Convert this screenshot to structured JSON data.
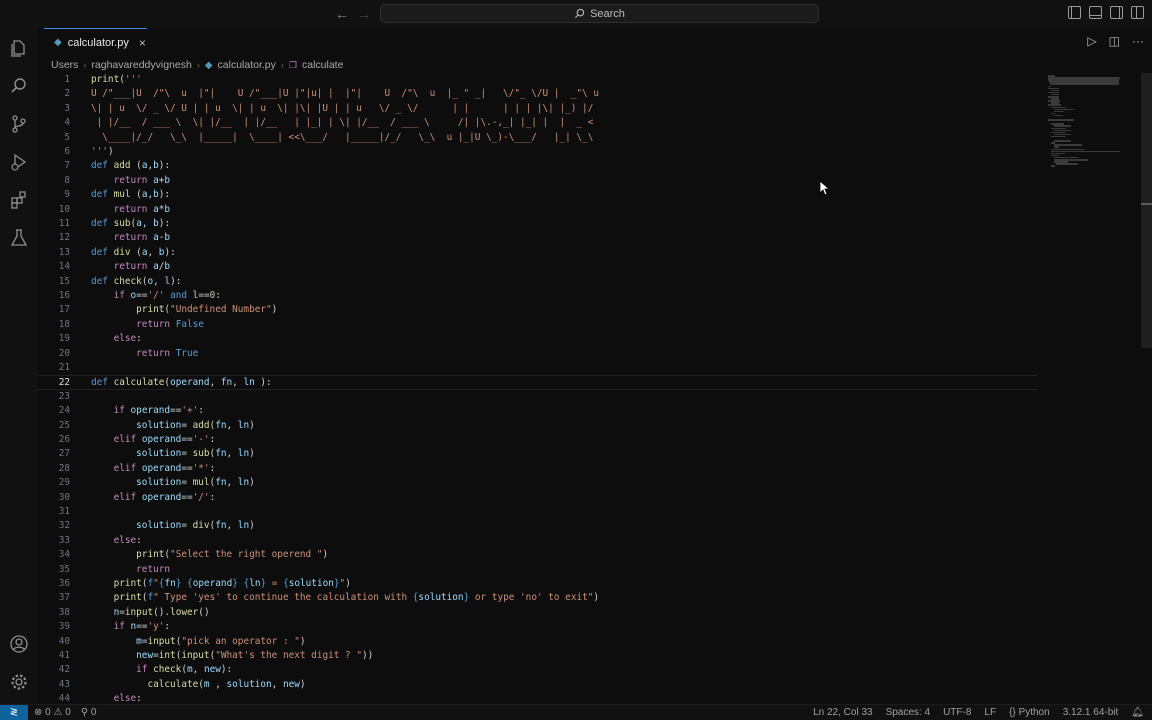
{
  "window": {
    "search_label": "Search"
  },
  "tab": {
    "filename": "calculator.py",
    "close": "×"
  },
  "breadcrumbs": {
    "items": [
      "Users",
      "raghavareddyvignesh",
      "calculator.py",
      "calculate"
    ]
  },
  "editor": {
    "active_line": 22,
    "lines": [
      {
        "n": "1",
        "html": "<span class=\"fn\">print</span>(<span class=\"str\">'''</span>"
      },
      {
        "n": "2",
        "html": "<span class=\"art\">U /\"___|U  /\"\\  u  |\"|    U /\"___|U |\"|u| |  |\"|    U  /\"\\  u  |_ \" _|   \\/\"_ \\/U |  _\"\\ u</span>"
      },
      {
        "n": "3",
        "html": "<span class=\"art\">\\| | u  \\/ _ \\/ U | | u  \\| | u  \\| |\\| |U | | u   \\/ _ \\/      | |      | | | |\\| |_) |/</span>"
      },
      {
        "n": "4",
        "html": "<span class=\"art\"> | |/__  / ___ \\  \\| |/__  | |/__   | |_| | \\| |/__  / ___ \\     /| |\\.-,_| |_| |  |  _ <</span>"
      },
      {
        "n": "5",
        "html": "<span class=\"art\">  \\____|/_/   \\_\\  |_____|  \\____| <<\\___/   |_____|/_/   \\_\\  u |_|U \\_)-\\___/   |_| \\_\\</span>"
      },
      {
        "n": "6",
        "html": "<span class=\"str\">'''</span>)"
      },
      {
        "n": "7",
        "html": "<span class=\"kw\">def</span> <span class=\"fn\">add</span> (<span class=\"var\">a</span>,<span class=\"var\">b</span>):"
      },
      {
        "n": "8",
        "html": "    <span class=\"kw2\">return</span> <span class=\"var\">a</span>+<span class=\"var\">b</span>"
      },
      {
        "n": "9",
        "html": "<span class=\"kw\">def</span> <span class=\"fn\">mul</span> (<span class=\"var\">a</span>,<span class=\"var\">b</span>):"
      },
      {
        "n": "10",
        "html": "    <span class=\"kw2\">return</span> <span class=\"var\">a</span>*<span class=\"var\">b</span>"
      },
      {
        "n": "11",
        "html": "<span class=\"kw\">def</span> <span class=\"fn\">sub</span>(<span class=\"var\">a</span>, <span class=\"var\">b</span>):"
      },
      {
        "n": "12",
        "html": "    <span class=\"kw2\">return</span> <span class=\"var\">a</span>-<span class=\"var\">b</span>"
      },
      {
        "n": "13",
        "html": "<span class=\"kw\">def</span> <span class=\"fn\">div</span> (<span class=\"var\">a</span>, <span class=\"var\">b</span>):"
      },
      {
        "n": "14",
        "html": "    <span class=\"kw2\">return</span> <span class=\"var\">a</span>/<span class=\"var\">b</span>"
      },
      {
        "n": "15",
        "html": "<span class=\"kw\">def</span> <span class=\"fn\">check</span>(<span class=\"var\">o</span>, <span class=\"var\">l</span>):"
      },
      {
        "n": "16",
        "html": "    <span class=\"kw2\">if</span> <span class=\"var\">o</span>==<span class=\"str\">'/'</span> <span class=\"kw\">and</span> <span class=\"var\">l</span>==<span class=\"num\">0</span>:"
      },
      {
        "n": "17",
        "html": "        <span class=\"fn\">print</span>(<span class=\"str\">\"Undefined Number\"</span>)"
      },
      {
        "n": "18",
        "html": "        <span class=\"kw2\">return</span> <span class=\"con\">False</span>"
      },
      {
        "n": "19",
        "html": "    <span class=\"kw2\">else</span>:"
      },
      {
        "n": "20",
        "html": "        <span class=\"kw2\">return</span> <span class=\"con\">True</span>"
      },
      {
        "n": "21",
        "html": ""
      },
      {
        "n": "22",
        "html": "<span class=\"kw\">def</span> <span class=\"fn\">calculate</span>(<span class=\"var\">operand</span>, <span class=\"var\">fn</span>, <span class=\"var\">ln</span> ):"
      },
      {
        "n": "23",
        "html": ""
      },
      {
        "n": "24",
        "html": "    <span class=\"kw2\">if</span> <span class=\"var\">operand</span>==<span class=\"str\">'+'</span>:"
      },
      {
        "n": "25",
        "html": "        <span class=\"var\">solution</span>= <span class=\"fn\">add</span>(<span class=\"var\">fn</span>, <span class=\"var\">ln</span>)"
      },
      {
        "n": "26",
        "html": "    <span class=\"kw2\">elif</span> <span class=\"var\">operand</span>==<span class=\"str\">'-'</span>:"
      },
      {
        "n": "27",
        "html": "        <span class=\"var\">solution</span>= <span class=\"fn\">sub</span>(<span class=\"var\">fn</span>, <span class=\"var\">ln</span>)"
      },
      {
        "n": "28",
        "html": "    <span class=\"kw2\">elif</span> <span class=\"var\">operand</span>==<span class=\"str\">'*'</span>:"
      },
      {
        "n": "29",
        "html": "        <span class=\"var\">solution</span>= <span class=\"fn\">mul</span>(<span class=\"var\">fn</span>, <span class=\"var\">ln</span>)"
      },
      {
        "n": "30",
        "html": "    <span class=\"kw2\">elif</span> <span class=\"var\">operand</span>==<span class=\"str\">'/'</span>:"
      },
      {
        "n": "31",
        "html": ""
      },
      {
        "n": "32",
        "html": "        <span class=\"var\">solution</span>= <span class=\"fn\">div</span>(<span class=\"var\">fn</span>, <span class=\"var\">ln</span>)"
      },
      {
        "n": "33",
        "html": "    <span class=\"kw2\">else</span>:"
      },
      {
        "n": "34",
        "html": "        <span class=\"fn\">print</span>(<span class=\"str\">\"Select the right operend \"</span>)"
      },
      {
        "n": "35",
        "html": "        <span class=\"kw2\">return</span>"
      },
      {
        "n": "36",
        "html": "    <span class=\"fn\">print</span>(<span class=\"kw\">f</span><span class=\"str\">\"</span><span class=\"con\">{</span><span class=\"var\">fn</span><span class=\"con\">}</span> <span class=\"con\">{</span><span class=\"var\">operand</span><span class=\"con\">}</span> <span class=\"con\">{</span><span class=\"var\">ln</span><span class=\"con\">}</span><span class=\"str\"> = </span><span class=\"con\">{</span><span class=\"var\">solution</span><span class=\"con\">}</span><span class=\"str\">\"</span>)"
      },
      {
        "n": "37",
        "html": "    <span class=\"fn\">print</span>(<span class=\"kw\">f</span><span class=\"str\">\" Type 'yes' to continue the calculation with </span><span class=\"con\">{</span><span class=\"var\">solution</span><span class=\"con\">}</span><span class=\"str\"> or type 'no' to exit\"</span>)"
      },
      {
        "n": "38",
        "html": "    <span class=\"var\">n</span>=<span class=\"fn\">input</span>().<span class=\"fn\">lower</span>()"
      },
      {
        "n": "39",
        "html": "    <span class=\"kw2\">if</span> <span class=\"var\">n</span>==<span class=\"str\">'y'</span>:"
      },
      {
        "n": "40",
        "html": "        <span class=\"var\">m</span>=<span class=\"fn\">input</span>(<span class=\"str\">\"pick an operator : \"</span>)"
      },
      {
        "n": "41",
        "html": "        <span class=\"var\">new</span>=<span class=\"fn\">int</span>(<span class=\"fn\">input</span>(<span class=\"str\">\"What's the next digit ? \"</span>))"
      },
      {
        "n": "42",
        "html": "        <span class=\"kw2\">if</span> <span class=\"fn\">check</span>(<span class=\"var\">m</span>, <span class=\"var\">new</span>):"
      },
      {
        "n": "43",
        "html": "          <span class=\"fn\">calculate</span>(<span class=\"var\">m</span> , <span class=\"var\">solution</span>, <span class=\"var\">new</span>)"
      },
      {
        "n": "44",
        "html": "    <span class=\"kw2\">else</span>:"
      }
    ]
  },
  "statusbar": {
    "problems": "⊗ 0 ⚠ 0",
    "ports": "⚲ 0",
    "cursor_position": "Ln 22, Col 33",
    "indent": "Spaces: 4",
    "encoding": "UTF-8",
    "eol": "LF",
    "language": "Python",
    "interpreter": "3.12.1 64-bit"
  }
}
